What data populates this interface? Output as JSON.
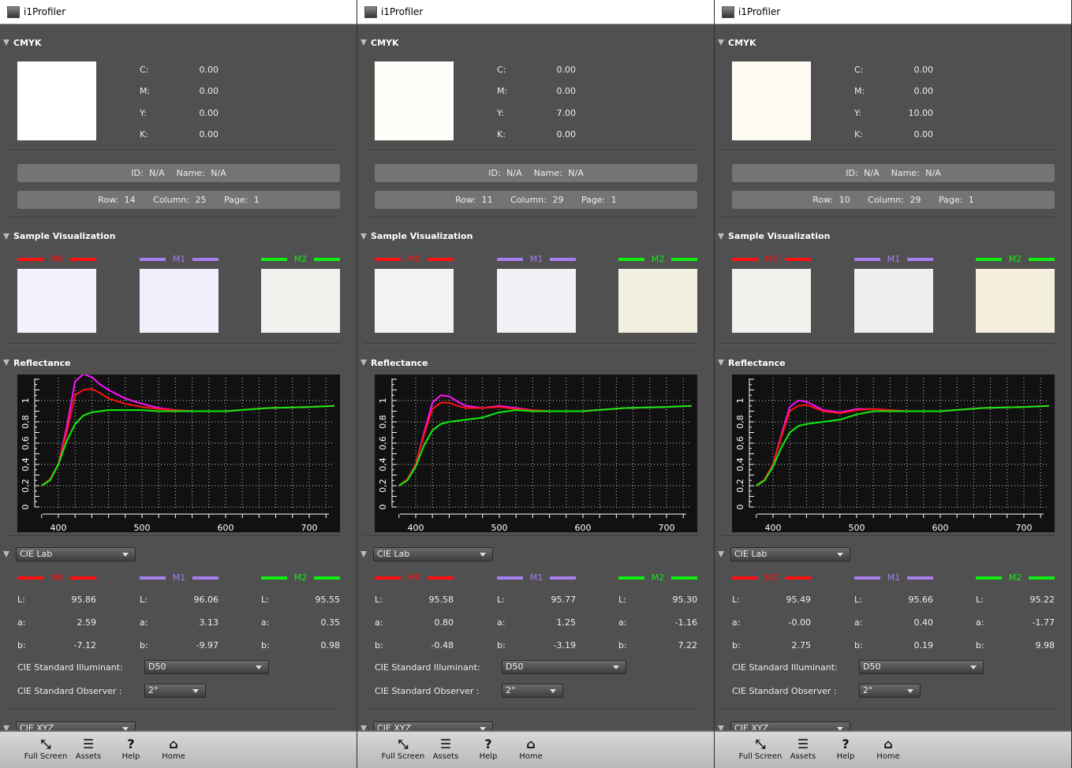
{
  "app_title": "i1Profiler",
  "labels": {
    "cmyk": "CMYK",
    "c": "C:",
    "m": "M:",
    "y": "Y:",
    "k": "K:",
    "sample_vis": "Sample Visualization",
    "reflectance": "Reflectance",
    "L": "L:",
    "a": "a:",
    "b": "b:",
    "illuminant": "CIE Standard Illuminant:",
    "observer": "CIE Standard Observer :",
    "m0": "M0",
    "m1": "M1",
    "m2": "M2",
    "xyz": "CIE XYZ"
  },
  "colors": {
    "m0": "#ff1010",
    "m1": "#a77ef0",
    "m2": "#10ee10",
    "m1_curve": "#ff10ff"
  },
  "toolbar": [
    {
      "label": "Full Screen",
      "icon": "fullscreen-icon",
      "glyph": "⤡"
    },
    {
      "label": "Assets",
      "icon": "list-icon",
      "glyph": "☰"
    },
    {
      "label": "Help",
      "icon": "help-icon",
      "glyph": "?"
    },
    {
      "label": "Home",
      "icon": "home-icon",
      "glyph": "⌂"
    }
  ],
  "panels": [
    {
      "cmyk": {
        "c": "0.00",
        "m": "0.00",
        "y": "0.00",
        "k": "0.00",
        "swatch": "#ffffff"
      },
      "id_text": "ID: N/A  Name: N/A",
      "pos_text": "Row: 14   Column: 25   Page: 1",
      "swatches": [
        "#f3f3fe",
        "#f0f0fd",
        "#f2f1ed"
      ],
      "color_space": "CIE Lab",
      "lab": [
        {
          "L": "95.86",
          "a": "2.59",
          "b": "-7.12"
        },
        {
          "L": "96.06",
          "a": "3.13",
          "b": "-9.97"
        },
        {
          "L": "95.55",
          "a": "0.35",
          "b": "0.98"
        }
      ],
      "illuminant": "D50",
      "observer": "2°",
      "chart_data": {
        "type": "line",
        "xlabel": "",
        "ylabel": "",
        "xlim": [
          380,
          730
        ],
        "ylim": [
          0,
          1.25
        ],
        "x_ticks": [
          "400",
          "500",
          "600",
          "700"
        ],
        "y_ticks": [
          "0",
          "0,2",
          "0,4",
          "0,6",
          "0,8",
          "1"
        ],
        "x": [
          380,
          390,
          400,
          410,
          420,
          430,
          440,
          450,
          460,
          480,
          500,
          520,
          540,
          560,
          600,
          650,
          700,
          730
        ],
        "series": [
          {
            "name": "M0",
            "values": [
              0.2,
              0.26,
              0.4,
              0.7,
              1.05,
              1.1,
              1.11,
              1.07,
              1.02,
              0.97,
              0.94,
              0.92,
              0.91,
              0.9,
              0.9,
              0.93,
              0.94,
              0.95
            ]
          },
          {
            "name": "M1",
            "values": [
              0.2,
              0.26,
              0.4,
              0.75,
              1.18,
              1.25,
              1.22,
              1.15,
              1.1,
              1.02,
              0.97,
              0.93,
              0.91,
              0.9,
              0.9,
              0.93,
              0.94,
              0.95
            ]
          },
          {
            "name": "M2",
            "values": [
              0.2,
              0.25,
              0.4,
              0.62,
              0.78,
              0.86,
              0.89,
              0.9,
              0.91,
              0.91,
              0.91,
              0.9,
              0.9,
              0.9,
              0.9,
              0.93,
              0.94,
              0.95
            ]
          }
        ]
      }
    },
    {
      "cmyk": {
        "c": "0.00",
        "m": "0.00",
        "y": "7.00",
        "k": "0.00",
        "swatch": "#fffef8"
      },
      "id_text": "ID: N/A  Name: N/A",
      "pos_text": "Row: 11   Column: 29   Page: 1",
      "swatches": [
        "#f3f2f0",
        "#f1f1f5",
        "#f4f0e0"
      ],
      "color_space": "CIE Lab",
      "lab": [
        {
          "L": "95.58",
          "a": "0.80",
          "b": "-0.48"
        },
        {
          "L": "95.77",
          "a": "1.25",
          "b": "-3.19"
        },
        {
          "L": "95.30",
          "a": "-1.16",
          "b": "7.22"
        }
      ],
      "illuminant": "D50",
      "observer": "2°",
      "chart_data": {
        "type": "line",
        "xlabel": "",
        "ylabel": "",
        "xlim": [
          380,
          730
        ],
        "ylim": [
          0,
          1.25
        ],
        "x_ticks": [
          "400",
          "500",
          "600",
          "700"
        ],
        "y_ticks": [
          "0",
          "0,2",
          "0,4",
          "0,6",
          "0,8",
          "1"
        ],
        "x": [
          380,
          390,
          400,
          410,
          420,
          430,
          440,
          450,
          460,
          480,
          500,
          520,
          540,
          560,
          600,
          650,
          700,
          730
        ],
        "series": [
          {
            "name": "M0",
            "values": [
              0.2,
              0.26,
              0.4,
              0.68,
              0.92,
              0.98,
              0.98,
              0.95,
              0.93,
              0.93,
              0.94,
              0.92,
              0.91,
              0.9,
              0.9,
              0.93,
              0.94,
              0.95
            ]
          },
          {
            "name": "M1",
            "values": [
              0.2,
              0.26,
              0.4,
              0.7,
              0.98,
              1.05,
              1.04,
              0.99,
              0.95,
              0.93,
              0.95,
              0.93,
              0.91,
              0.9,
              0.9,
              0.93,
              0.94,
              0.95
            ]
          },
          {
            "name": "M2",
            "values": [
              0.2,
              0.25,
              0.38,
              0.58,
              0.72,
              0.78,
              0.8,
              0.81,
              0.82,
              0.84,
              0.89,
              0.91,
              0.9,
              0.9,
              0.9,
              0.93,
              0.94,
              0.95
            ]
          }
        ]
      }
    },
    {
      "cmyk": {
        "c": "0.00",
        "m": "0.00",
        "y": "10.00",
        "k": "0.00",
        "swatch": "#fefcf2"
      },
      "id_text": "ID: N/A  Name: N/A",
      "pos_text": "Row: 10   Column: 29   Page: 1",
      "swatches": [
        "#f2f0ec",
        "#efeff0",
        "#f5efdd"
      ],
      "color_space": "CIE Lab",
      "lab": [
        {
          "L": "95.49",
          "a": "-0.00",
          "b": "2.75"
        },
        {
          "L": "95.66",
          "a": "0.40",
          "b": "0.19"
        },
        {
          "L": "95.22",
          "a": "-1.77",
          "b": "9.98"
        }
      ],
      "illuminant": "D50",
      "observer": "2°",
      "chart_data": {
        "type": "line",
        "xlabel": "",
        "ylabel": "",
        "xlim": [
          380,
          730
        ],
        "ylim": [
          0,
          1.25
        ],
        "x_ticks": [
          "400",
          "500",
          "600",
          "700"
        ],
        "y_ticks": [
          "0",
          "0,2",
          "0,4",
          "0,6",
          "0,8",
          "1"
        ],
        "x": [
          380,
          390,
          400,
          410,
          420,
          430,
          440,
          450,
          460,
          480,
          500,
          520,
          540,
          560,
          600,
          650,
          700,
          730
        ],
        "series": [
          {
            "name": "M0",
            "values": [
              0.2,
              0.26,
              0.4,
              0.66,
              0.9,
              0.95,
              0.96,
              0.93,
              0.9,
              0.88,
              0.91,
              0.92,
              0.91,
              0.9,
              0.9,
              0.93,
              0.94,
              0.95
            ]
          },
          {
            "name": "M1",
            "values": [
              0.2,
              0.26,
              0.4,
              0.68,
              0.94,
              1.0,
              0.99,
              0.95,
              0.91,
              0.89,
              0.92,
              0.92,
              0.91,
              0.9,
              0.9,
              0.93,
              0.94,
              0.95
            ]
          },
          {
            "name": "M2",
            "values": [
              0.2,
              0.25,
              0.38,
              0.56,
              0.7,
              0.76,
              0.78,
              0.79,
              0.8,
              0.82,
              0.87,
              0.9,
              0.9,
              0.9,
              0.9,
              0.93,
              0.94,
              0.95
            ]
          }
        ]
      }
    }
  ]
}
